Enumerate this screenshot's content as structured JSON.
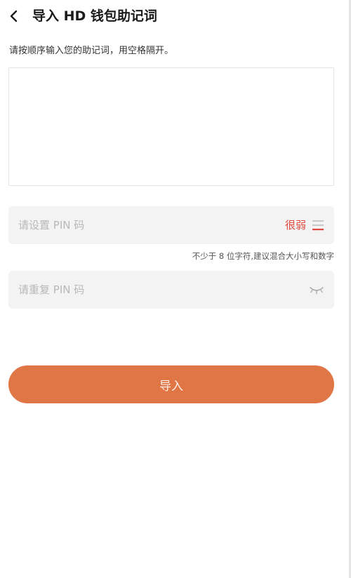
{
  "header": {
    "title": "导入 HD 钱包助记词",
    "back_icon": "back-chevron-icon"
  },
  "mnemonic": {
    "instruction": "请按顺序输入您的助记词，用空格隔开。",
    "value": "",
    "placeholder": ""
  },
  "pin": {
    "placeholder": "请设置 PIN 码",
    "value": "",
    "strength_label": "很弱",
    "strength_color": "#e0473d",
    "strength_icon": "strength-bars-icon",
    "hint": "不少于 8 位字符,建议混合大小写和数字"
  },
  "pin_confirm": {
    "placeholder": "请重复 PIN 码",
    "value": "",
    "visibility_icon": "eye-closed-icon"
  },
  "actions": {
    "import_label": "导入",
    "import_color": "#e07545"
  }
}
